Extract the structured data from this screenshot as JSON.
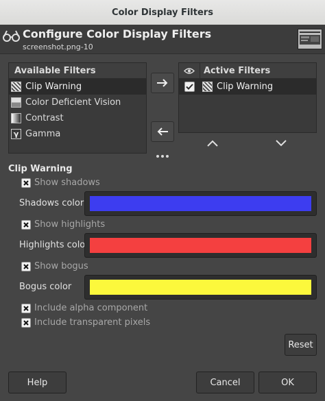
{
  "window": {
    "title": "Color Display Filters"
  },
  "header": {
    "title": "Configure Color Display Filters",
    "subtitle": "screenshot.png-10"
  },
  "available": {
    "heading": "Available Filters",
    "items": [
      {
        "label": "Clip Warning",
        "icon": "clip-warning-icon"
      },
      {
        "label": "Color Deficient Vision",
        "icon": "color-deficient-vision-icon"
      },
      {
        "label": "Contrast",
        "icon": "contrast-icon"
      },
      {
        "label": "Gamma",
        "icon": "gamma-icon",
        "glyph": "γ"
      }
    ]
  },
  "active": {
    "heading": "Active Filters",
    "items": [
      {
        "label": "Clip Warning",
        "enabled": true
      }
    ]
  },
  "clip": {
    "title": "Clip Warning",
    "show_shadows": "Show shadows",
    "shadows_color_label": "Shadows color",
    "shadows_color": "#3d3df0",
    "show_highlights": "Show highlights",
    "highlights_color_label": "Highlights color",
    "highlights_color": "#f44040",
    "show_bogus": "Show bogus",
    "bogus_color_label": "Bogus color",
    "bogus_color": "#fcf83c",
    "include_alpha": "Include alpha component",
    "include_transparent": "Include transparent pixels"
  },
  "buttons": {
    "reset": "Reset",
    "help": "Help",
    "cancel": "Cancel",
    "ok": "OK"
  }
}
